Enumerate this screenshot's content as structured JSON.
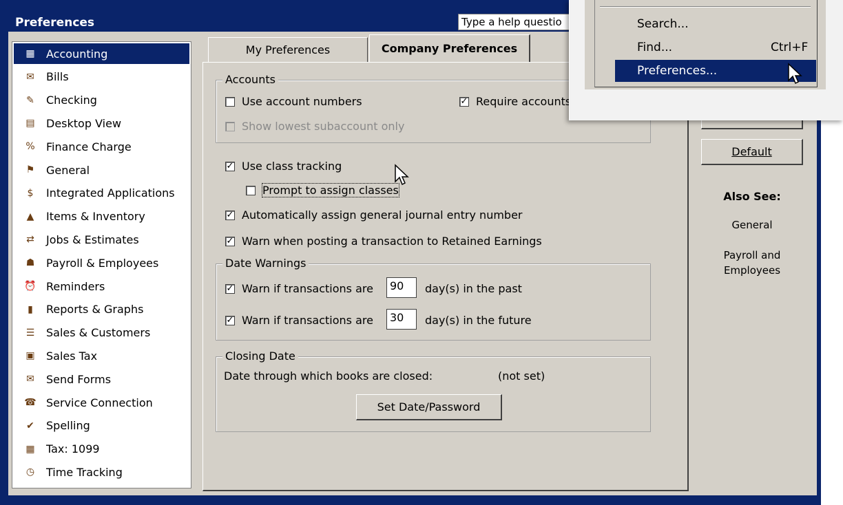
{
  "window": {
    "title": "Preferences",
    "help_placeholder": "Type a help questio"
  },
  "sidebar": {
    "items": [
      {
        "label": "Accounting",
        "icon": "accounting-icon",
        "glyph": "▦"
      },
      {
        "label": "Bills",
        "icon": "bills-icon",
        "glyph": "✉"
      },
      {
        "label": "Checking",
        "icon": "checking-icon",
        "glyph": "✎"
      },
      {
        "label": "Desktop View",
        "icon": "desktop-view-icon",
        "glyph": "▤"
      },
      {
        "label": "Finance Charge",
        "icon": "finance-charge-icon",
        "glyph": "%"
      },
      {
        "label": "General",
        "icon": "general-icon",
        "glyph": "⚑"
      },
      {
        "label": "Integrated Applications",
        "icon": "integrated-applications-icon",
        "glyph": "$"
      },
      {
        "label": "Items & Inventory",
        "icon": "items-inventory-icon",
        "glyph": "▲"
      },
      {
        "label": "Jobs & Estimates",
        "icon": "jobs-estimates-icon",
        "glyph": "⇄"
      },
      {
        "label": "Payroll & Employees",
        "icon": "payroll-employees-icon",
        "glyph": "☗"
      },
      {
        "label": "Reminders",
        "icon": "reminders-icon",
        "glyph": "⏰"
      },
      {
        "label": "Reports & Graphs",
        "icon": "reports-graphs-icon",
        "glyph": "▮"
      },
      {
        "label": "Sales & Customers",
        "icon": "sales-customers-icon",
        "glyph": "☰"
      },
      {
        "label": "Sales Tax",
        "icon": "sales-tax-icon",
        "glyph": "▣"
      },
      {
        "label": "Send Forms",
        "icon": "send-forms-icon",
        "glyph": "✉"
      },
      {
        "label": "Service Connection",
        "icon": "service-connection-icon",
        "glyph": "☎"
      },
      {
        "label": "Spelling",
        "icon": "spelling-icon",
        "glyph": "✔"
      },
      {
        "label": "Tax: 1099",
        "icon": "tax-1099-icon",
        "glyph": "▦"
      },
      {
        "label": "Time Tracking",
        "icon": "time-tracking-icon",
        "glyph": "◷"
      }
    ],
    "selected": "Accounting"
  },
  "tabs": {
    "my": "My Preferences",
    "company": "Company Preferences"
  },
  "accounts": {
    "legend": "Accounts",
    "use_account_numbers": "Use account numbers",
    "require_accounts": "Require accounts",
    "show_lowest": "Show lowest subaccount only"
  },
  "class": {
    "use_class_tracking": "Use class tracking",
    "prompt_assign": "Prompt to assign classes",
    "auto_assign": "Automatically assign general journal entry number",
    "warn_retained": "Warn when posting a transaction to Retained Earnings"
  },
  "date_warnings": {
    "legend": "Date Warnings",
    "warn_label": "Warn if transactions are",
    "past_value": "90",
    "past_suffix": "day(s) in the past",
    "future_value": "30",
    "future_suffix": "day(s) in the future"
  },
  "closing": {
    "legend": "Closing Date",
    "text": "Date through which books are closed:",
    "status": "(not set)",
    "button": "Set Date/Password"
  },
  "right": {
    "default_button": "Default",
    "also_see": "Also See:",
    "link_general": "General",
    "link_payroll_1": "Payroll and",
    "link_payroll_2": "Employees"
  },
  "menu": {
    "search": "Search...",
    "find": "Find...",
    "find_shortcut": "Ctrl+F",
    "preferences": "Preferences..."
  },
  "colors": {
    "selection": "#0a246a",
    "face": "#d4d0c8"
  }
}
